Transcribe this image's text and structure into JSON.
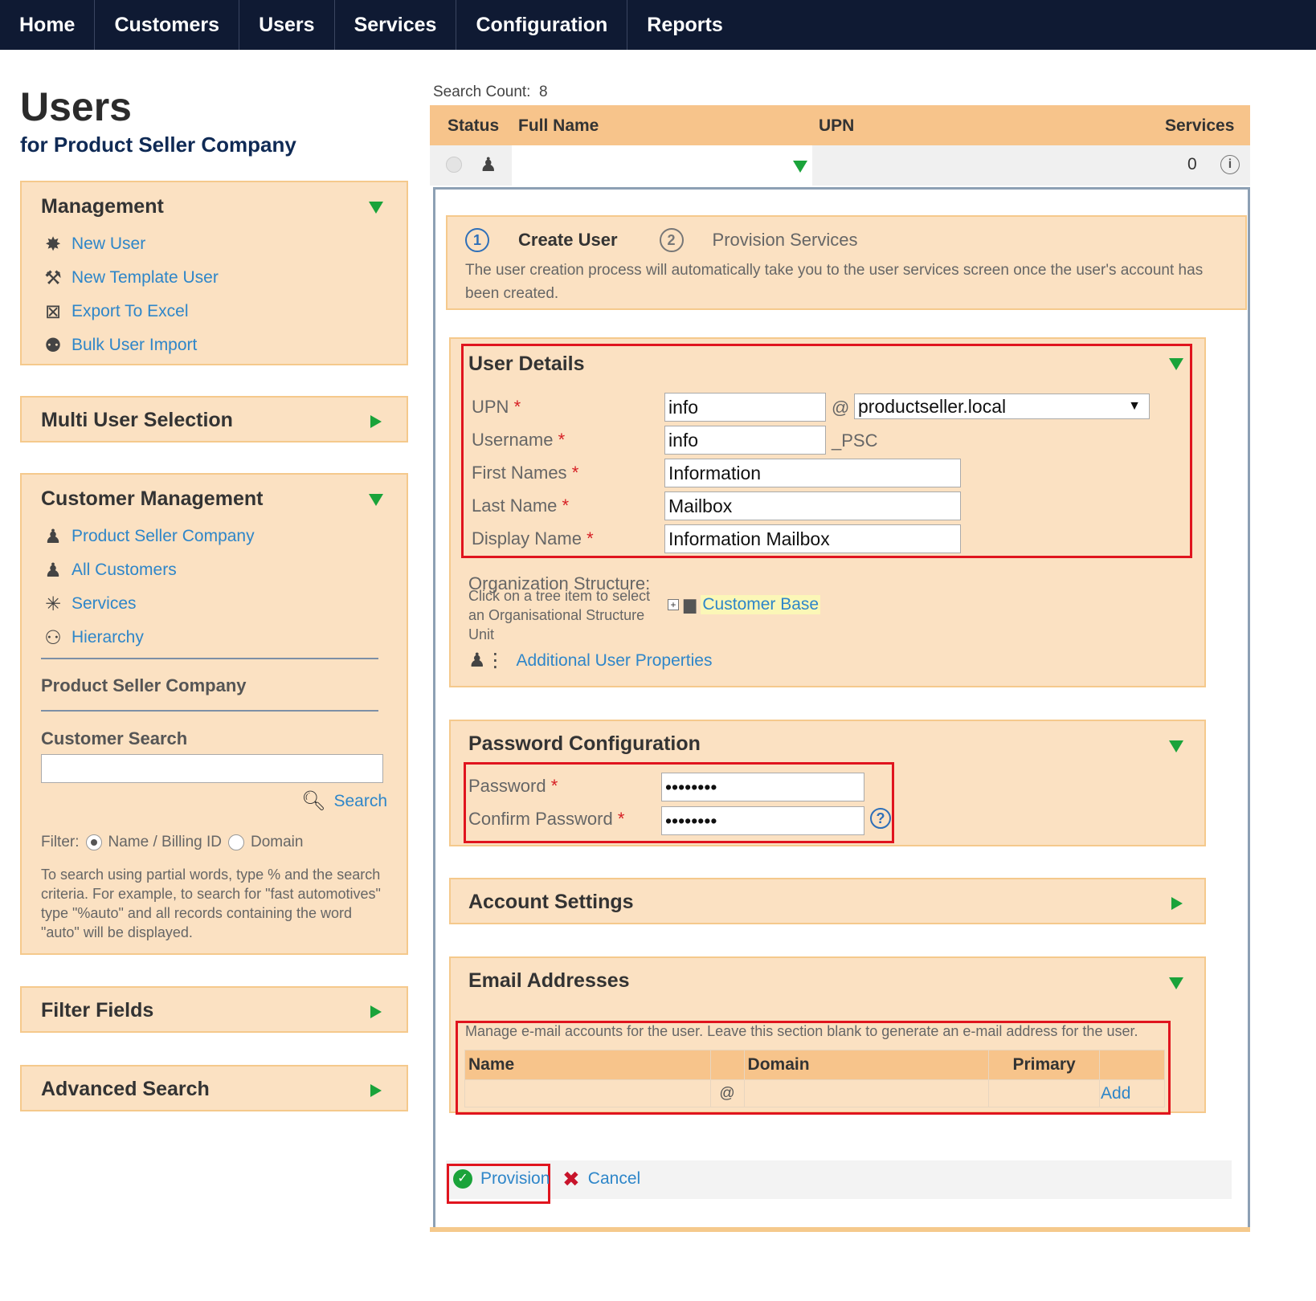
{
  "nav": [
    "Home",
    "Customers",
    "Users",
    "Services",
    "Configuration",
    "Reports"
  ],
  "page": {
    "title": "Users",
    "subtitle": "for Product Seller Company"
  },
  "sidebar": {
    "management": {
      "title": "Management",
      "items": [
        "New User",
        "New Template User",
        "Export To Excel",
        "Bulk User Import"
      ]
    },
    "multi_user": {
      "title": "Multi User Selection"
    },
    "customer_mgmt": {
      "title": "Customer Management",
      "items": [
        "Product Seller Company",
        "All Customers",
        "Services",
        "Hierarchy"
      ],
      "current": "Product Seller Company",
      "search_title": "Customer Search",
      "search_value": "",
      "search_button": "Search",
      "filter_label": "Filter:",
      "filter_options": [
        "Name / Billing ID",
        "Domain"
      ],
      "help": "To search using partial words, type % and the search criteria. For example, to search for \"fast automotives\" type \"%auto\" and all records containing the word \"auto\" will be displayed."
    },
    "filter_fields": {
      "title": "Filter Fields"
    },
    "advanced_search": {
      "title": "Advanced Search"
    }
  },
  "results": {
    "count_label": "Search Count:",
    "count": "8",
    "columns": [
      "Status",
      "Full Name",
      "UPN",
      "Services"
    ],
    "row_services": "0"
  },
  "wizard": {
    "step1_num": "1",
    "step1": "Create User",
    "step2_num": "2",
    "step2": "Provision Services",
    "note": "The user creation process will automatically take you to the user services screen once the user's account has been created."
  },
  "user_details": {
    "title": "User Details",
    "upn_label": "UPN",
    "upn_value": "info",
    "at": "@",
    "domain": "productseller.local",
    "username_label": "Username",
    "username_value": "info",
    "username_suffix": "_PSC",
    "first_label": "First Names",
    "first_value": "Information",
    "last_label": "Last Name",
    "last_value": "Mailbox",
    "display_label": "Display Name",
    "display_value": "Information Mailbox",
    "org_label": "Organization Structure:",
    "org_help": "Click on a tree item to select an Organisational Structure Unit",
    "org_item": "Customer Base",
    "additional": "Additional User Properties"
  },
  "password": {
    "title": "Password Configuration",
    "pw_label": "Password",
    "pw_value": "••••••••",
    "confirm_label": "Confirm Password",
    "confirm_value": "••••••••"
  },
  "account": {
    "title": "Account Settings"
  },
  "email": {
    "title": "Email Addresses",
    "note": "Manage e-mail accounts for the user. Leave this section blank to generate an e-mail address for the user.",
    "columns": [
      "Name",
      "Domain",
      "Primary"
    ],
    "at": "@",
    "add": "Add"
  },
  "actions": {
    "provision": "Provision",
    "cancel": "Cancel"
  },
  "colors": {
    "nav_bg": "#0f1a33",
    "panel_bg": "#fbe1c2",
    "panel_border": "#f5c98c",
    "header_bg": "#f7c48b",
    "link": "#2e86c9",
    "accent_green": "#1aa33a",
    "highlight_red": "#e0141e"
  }
}
